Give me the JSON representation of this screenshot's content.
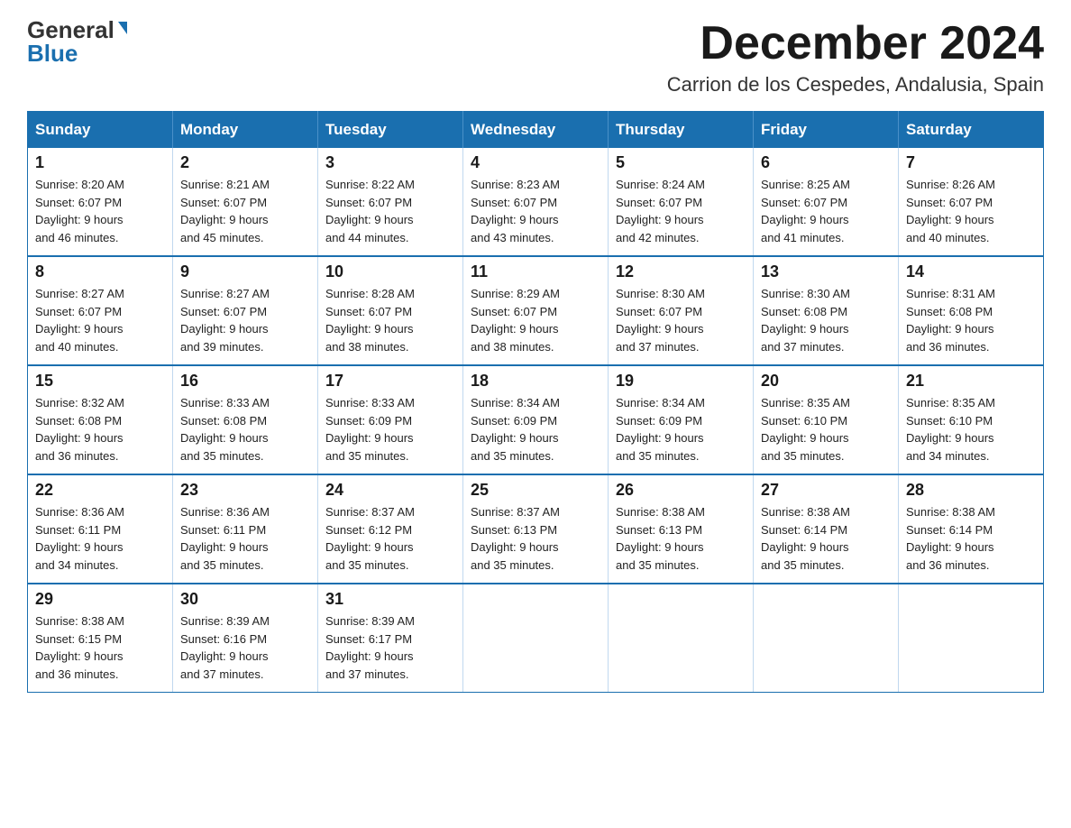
{
  "logo": {
    "general": "General",
    "blue": "Blue"
  },
  "title": "December 2024",
  "location": "Carrion de los Cespedes, Andalusia, Spain",
  "header_days": [
    "Sunday",
    "Monday",
    "Tuesday",
    "Wednesday",
    "Thursday",
    "Friday",
    "Saturday"
  ],
  "weeks": [
    [
      {
        "day": "1",
        "sunrise": "8:20 AM",
        "sunset": "6:07 PM",
        "daylight": "9 hours and 46 minutes."
      },
      {
        "day": "2",
        "sunrise": "8:21 AM",
        "sunset": "6:07 PM",
        "daylight": "9 hours and 45 minutes."
      },
      {
        "day": "3",
        "sunrise": "8:22 AM",
        "sunset": "6:07 PM",
        "daylight": "9 hours and 44 minutes."
      },
      {
        "day": "4",
        "sunrise": "8:23 AM",
        "sunset": "6:07 PM",
        "daylight": "9 hours and 43 minutes."
      },
      {
        "day": "5",
        "sunrise": "8:24 AM",
        "sunset": "6:07 PM",
        "daylight": "9 hours and 42 minutes."
      },
      {
        "day": "6",
        "sunrise": "8:25 AM",
        "sunset": "6:07 PM",
        "daylight": "9 hours and 41 minutes."
      },
      {
        "day": "7",
        "sunrise": "8:26 AM",
        "sunset": "6:07 PM",
        "daylight": "9 hours and 40 minutes."
      }
    ],
    [
      {
        "day": "8",
        "sunrise": "8:27 AM",
        "sunset": "6:07 PM",
        "daylight": "9 hours and 40 minutes."
      },
      {
        "day": "9",
        "sunrise": "8:27 AM",
        "sunset": "6:07 PM",
        "daylight": "9 hours and 39 minutes."
      },
      {
        "day": "10",
        "sunrise": "8:28 AM",
        "sunset": "6:07 PM",
        "daylight": "9 hours and 38 minutes."
      },
      {
        "day": "11",
        "sunrise": "8:29 AM",
        "sunset": "6:07 PM",
        "daylight": "9 hours and 38 minutes."
      },
      {
        "day": "12",
        "sunrise": "8:30 AM",
        "sunset": "6:07 PM",
        "daylight": "9 hours and 37 minutes."
      },
      {
        "day": "13",
        "sunrise": "8:30 AM",
        "sunset": "6:08 PM",
        "daylight": "9 hours and 37 minutes."
      },
      {
        "day": "14",
        "sunrise": "8:31 AM",
        "sunset": "6:08 PM",
        "daylight": "9 hours and 36 minutes."
      }
    ],
    [
      {
        "day": "15",
        "sunrise": "8:32 AM",
        "sunset": "6:08 PM",
        "daylight": "9 hours and 36 minutes."
      },
      {
        "day": "16",
        "sunrise": "8:33 AM",
        "sunset": "6:08 PM",
        "daylight": "9 hours and 35 minutes."
      },
      {
        "day": "17",
        "sunrise": "8:33 AM",
        "sunset": "6:09 PM",
        "daylight": "9 hours and 35 minutes."
      },
      {
        "day": "18",
        "sunrise": "8:34 AM",
        "sunset": "6:09 PM",
        "daylight": "9 hours and 35 minutes."
      },
      {
        "day": "19",
        "sunrise": "8:34 AM",
        "sunset": "6:09 PM",
        "daylight": "9 hours and 35 minutes."
      },
      {
        "day": "20",
        "sunrise": "8:35 AM",
        "sunset": "6:10 PM",
        "daylight": "9 hours and 35 minutes."
      },
      {
        "day": "21",
        "sunrise": "8:35 AM",
        "sunset": "6:10 PM",
        "daylight": "9 hours and 34 minutes."
      }
    ],
    [
      {
        "day": "22",
        "sunrise": "8:36 AM",
        "sunset": "6:11 PM",
        "daylight": "9 hours and 34 minutes."
      },
      {
        "day": "23",
        "sunrise": "8:36 AM",
        "sunset": "6:11 PM",
        "daylight": "9 hours and 35 minutes."
      },
      {
        "day": "24",
        "sunrise": "8:37 AM",
        "sunset": "6:12 PM",
        "daylight": "9 hours and 35 minutes."
      },
      {
        "day": "25",
        "sunrise": "8:37 AM",
        "sunset": "6:13 PM",
        "daylight": "9 hours and 35 minutes."
      },
      {
        "day": "26",
        "sunrise": "8:38 AM",
        "sunset": "6:13 PM",
        "daylight": "9 hours and 35 minutes."
      },
      {
        "day": "27",
        "sunrise": "8:38 AM",
        "sunset": "6:14 PM",
        "daylight": "9 hours and 35 minutes."
      },
      {
        "day": "28",
        "sunrise": "8:38 AM",
        "sunset": "6:14 PM",
        "daylight": "9 hours and 36 minutes."
      }
    ],
    [
      {
        "day": "29",
        "sunrise": "8:38 AM",
        "sunset": "6:15 PM",
        "daylight": "9 hours and 36 minutes."
      },
      {
        "day": "30",
        "sunrise": "8:39 AM",
        "sunset": "6:16 PM",
        "daylight": "9 hours and 37 minutes."
      },
      {
        "day": "31",
        "sunrise": "8:39 AM",
        "sunset": "6:17 PM",
        "daylight": "9 hours and 37 minutes."
      },
      null,
      null,
      null,
      null
    ]
  ],
  "labels": {
    "sunrise": "Sunrise:",
    "sunset": "Sunset:",
    "daylight": "Daylight:"
  }
}
